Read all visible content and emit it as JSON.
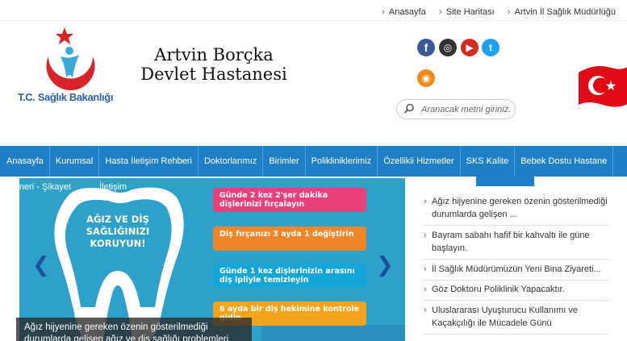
{
  "top_links": [
    "Anasayfa",
    "Site Haritası",
    "Artvin İl Sağlık Müdürlüğü"
  ],
  "logo_text": "T.C. Sağlık Bakanlığı",
  "hospital_name_line1": "Artvin Borçka",
  "hospital_name_line2": "Devlet Hastanesi",
  "social": {
    "facebook": "f",
    "instagram": "◎",
    "youtube": "▶",
    "twitter": "t",
    "rss": "◉"
  },
  "search": {
    "placeholder": "Aranacak metni giriniz..."
  },
  "nav": [
    "Anasayfa",
    "Kurumsal",
    "Hasta İletişim Rehberi",
    "Doktorlarımız",
    "Birimler",
    "Polikliniklerimiz",
    "Özellikli Hizmetler",
    "SKS Kalite",
    "Bebek Dostu Hastane"
  ],
  "nav2": [
    "k - Öneri - Şikayet",
    "İletişim"
  ],
  "slider": {
    "headline": "AĞIZ VE DİŞ SAĞLIĞINIZI KORUYUN!",
    "tips": [
      "Günde 2 kez 2'şer dakika dişlerinizi fırçalayın",
      "Diş fırçanızı 3 ayda 1 değiştirin",
      "Günde 1 kez dişlerinizin arasını diş ipliyle temizleyin",
      "6 ayda bir diş hekimine kontrole gidin"
    ],
    "caption": "Ağız hijyenine gereken özenin gösterilmediği durumlarda gelişen ağız ve diş sağlığı problemleri"
  },
  "news": [
    "Ağız hijyenine gereken özenin gösterilmediği durumlarda gelişen ...",
    "Bayram sabahı hafif bir kahvaltı ile güne başlayın.",
    "İl Sağlık Müdürümüzün Yeni Bina Ziyareti...",
    "Göz Doktoru Poliklinik Yapacaktır.",
    "Uluslararası Uyuşturucu Kullanımı ve Kaçakçılığı ile Mücadele Günü"
  ],
  "colors": {
    "nav": "#1e7fc6",
    "logo_blue": "#2e5fa8",
    "logo_red": "#d9232a",
    "slider_bg": "#2da1c9"
  }
}
